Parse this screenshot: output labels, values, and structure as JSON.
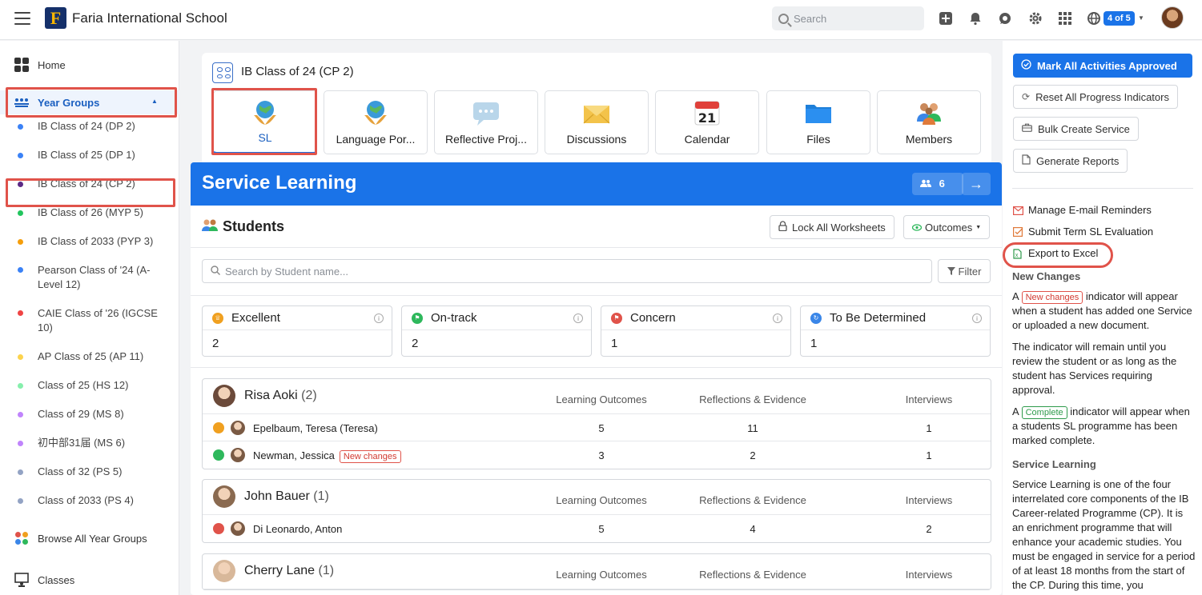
{
  "topbar": {
    "school_name": "Faria International School",
    "logo_letter": "F",
    "search_placeholder": "Search",
    "account_badge": "4 of 5"
  },
  "sidebar": {
    "home": "Home",
    "year_groups": "Year Groups",
    "items": [
      {
        "label": "IB Class of 24 (DP 2)",
        "color": "#3b82f6"
      },
      {
        "label": "IB Class of 25 (DP 1)",
        "color": "#3b82f6"
      },
      {
        "label": "IB Class of 24 (CP 2)",
        "color": "#5b2a86"
      },
      {
        "label": "IB Class of 26 (MYP 5)",
        "color": "#22c55e"
      },
      {
        "label": "IB Class of 2033 (PYP 3)",
        "color": "#f59e0b"
      },
      {
        "label": "Pearson Class of '24 (A-Level 12)",
        "color": "#3b82f6"
      },
      {
        "label": "CAIE Class of '26 (IGCSE 10)",
        "color": "#ef4444"
      },
      {
        "label": "AP Class of 25 (AP 11)",
        "color": "#fcd34d"
      },
      {
        "label": "Class of 25 (HS 12)",
        "color": "#86efac"
      },
      {
        "label": "Class of 29 (MS 8)",
        "color": "#c084fc"
      },
      {
        "label": "初中部31届 (MS 6)",
        "color": "#c084fc"
      },
      {
        "label": "Class of 32 (PS 5)",
        "color": "#93a3c4"
      },
      {
        "label": "Class of 2033 (PS 4)",
        "color": "#93a3c4"
      }
    ],
    "browse_all": "Browse All Year Groups",
    "classes": "Classes"
  },
  "main": {
    "class_title": "IB Class of 24 (CP 2)",
    "tiles": [
      {
        "label": "SL",
        "icon": "globe-hands-icon"
      },
      {
        "label": "Language Por...",
        "icon": "globe-hands-icon"
      },
      {
        "label": "Reflective Proj...",
        "icon": "speech-bubble-icon"
      },
      {
        "label": "Discussions",
        "icon": "envelope-icon"
      },
      {
        "label": "Calendar",
        "icon": "calendar-icon",
        "day": "21"
      },
      {
        "label": "Files",
        "icon": "folder-icon"
      },
      {
        "label": "Members",
        "icon": "people-icon"
      }
    ],
    "service_learning_title": "Service Learning",
    "member_count": "6",
    "students_title": "Students",
    "lock_worksheets": "Lock All Worksheets",
    "outcomes": "Outcomes",
    "student_search_placeholder": "Search by Student name...",
    "filter": "Filter",
    "stats": [
      {
        "label": "Excellent",
        "value": "2",
        "color": "#f0a020"
      },
      {
        "label": "On-track",
        "value": "2",
        "color": "#2eb85c"
      },
      {
        "label": "Concern",
        "value": "1",
        "color": "#e0534a"
      },
      {
        "label": "To Be Determined",
        "value": "1",
        "color": "#3a86e8"
      }
    ],
    "columns": [
      "Learning Outcomes",
      "Reflections & Evidence",
      "Interviews"
    ],
    "advisors": [
      {
        "name": "Risa Aoki",
        "count": "(2)",
        "students": [
          {
            "name": "Epelbaum, Teresa (Teresa)",
            "status_color": "#f0a020",
            "new": "",
            "lo": "5",
            "re": "11",
            "iv": "1"
          },
          {
            "name": "Newman, Jessica",
            "status_color": "#2eb85c",
            "new": "New changes",
            "lo": "3",
            "re": "2",
            "iv": "1"
          }
        ]
      },
      {
        "name": "John Bauer",
        "count": "(1)",
        "students": [
          {
            "name": "Di Leonardo, Anton",
            "status_color": "#e0534a",
            "new": "",
            "lo": "5",
            "re": "4",
            "iv": "2"
          }
        ]
      },
      {
        "name": "Cherry Lane",
        "count": "(1)",
        "students": []
      }
    ]
  },
  "right": {
    "mark_approved": "Mark All Activities Approved",
    "reset_progress": "Reset All Progress Indicators",
    "bulk_create": "Bulk Create Service",
    "generate_reports": "Generate Reports",
    "manage_reminders": "Manage E-mail Reminders",
    "submit_evaluation": "Submit Term SL Evaluation",
    "export_excel": "Export to Excel",
    "new_changes_heading": "New Changes",
    "nc_prefix": "A",
    "nc_tag": "New changes",
    "nc_text": "indicator will appear when a student has added one Service or uploaded a new document.",
    "nc_text2": "The indicator will remain until you review the student or as long as the student has Services requiring approval.",
    "complete_prefix": "A",
    "complete_tag": "Complete",
    "complete_text": "indicator will appear when a students SL programme has been marked complete.",
    "sl_heading": "Service Learning",
    "sl_text": "Service Learning is one of the four interrelated core components of the IB Career-related Programme (CP). It is an enrichment programme that will enhance your academic studies. You must be engaged in service for a period of at least 18 months from the start of the CP. During this time, you"
  }
}
